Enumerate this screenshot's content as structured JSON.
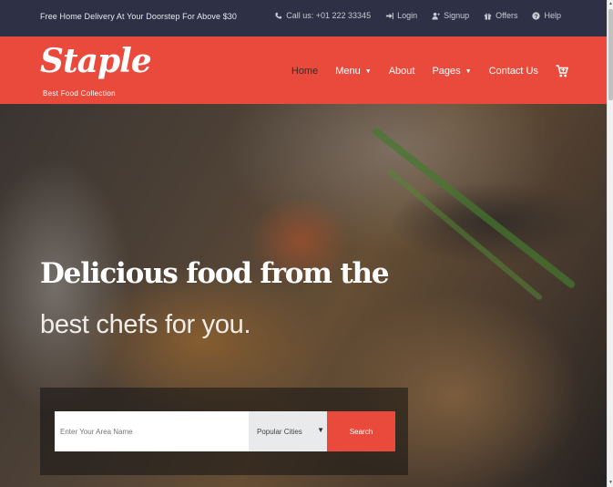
{
  "topbar": {
    "promo": "Free Home Delivery At Your Doorstep For Above $30",
    "links": [
      {
        "label": "Call us: +01 222 33345",
        "icon": "phone-icon"
      },
      {
        "label": "Login",
        "icon": "login-icon"
      },
      {
        "label": "Signup",
        "icon": "user-plus-icon"
      },
      {
        "label": "Offers",
        "icon": "gift-icon"
      },
      {
        "label": "Help",
        "icon": "help-icon"
      }
    ]
  },
  "header": {
    "logo": "Staple",
    "tagline": "Best Food Collection",
    "nav": [
      {
        "label": "Home",
        "active": true
      },
      {
        "label": "Menu",
        "dropdown": true
      },
      {
        "label": "About"
      },
      {
        "label": "Pages",
        "dropdown": true
      },
      {
        "label": "Contact Us"
      }
    ],
    "cart_icon": "shopping-cart-icon"
  },
  "hero": {
    "headline": "Delicious food from the",
    "subline": "best chefs for you.",
    "search": {
      "area_placeholder": "Enter Your Area Name",
      "city_selected": "Popular Cities",
      "button": "Search"
    }
  },
  "colors": {
    "brand": "#ea4a3c",
    "topbar": "#2e3046"
  }
}
